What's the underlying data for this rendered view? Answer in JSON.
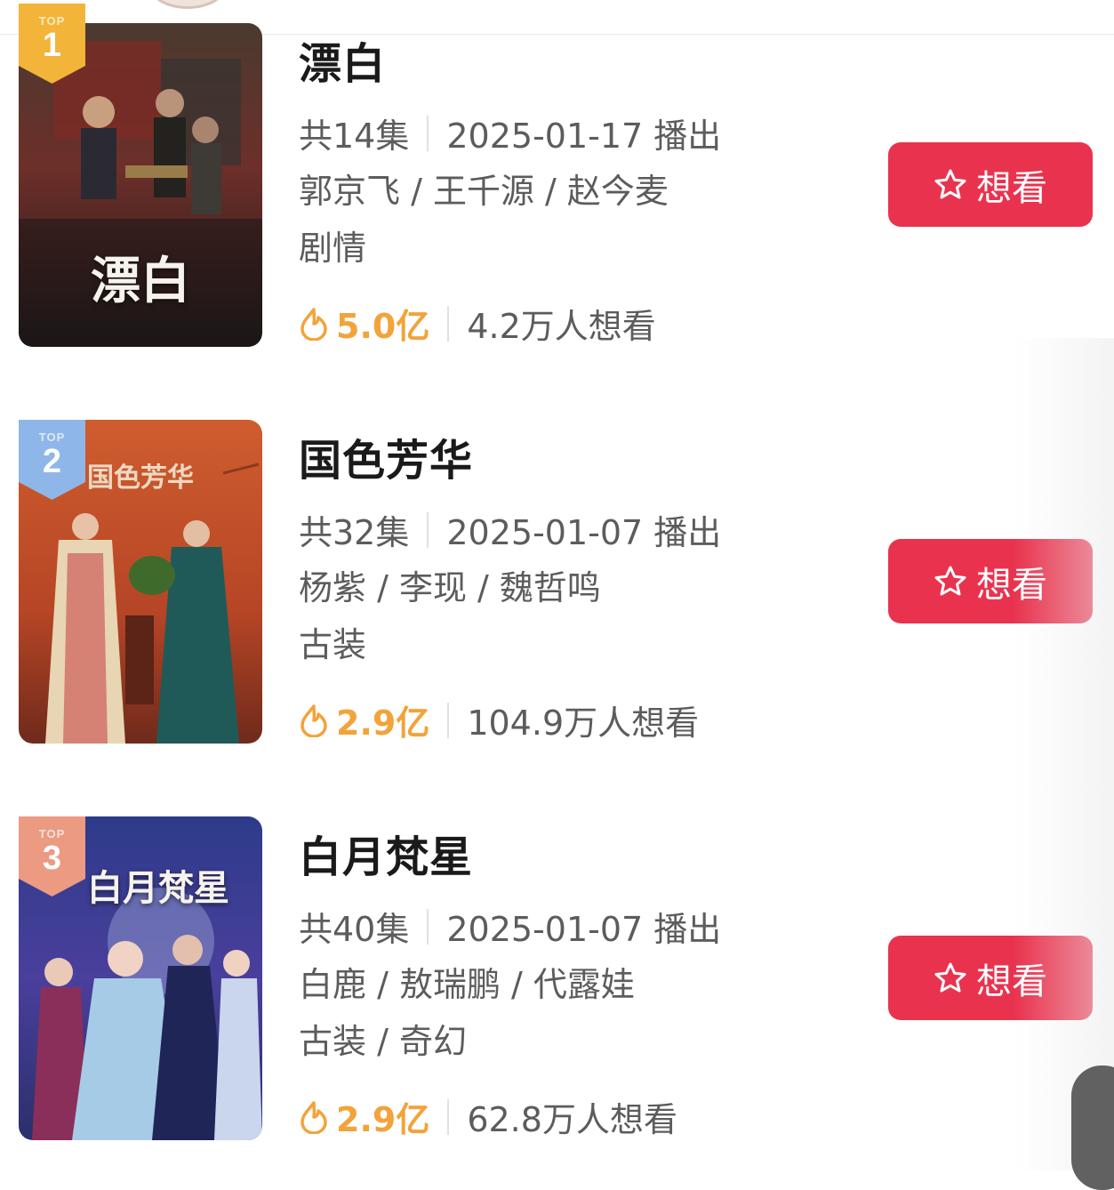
{
  "dramas": [
    {
      "rank": "1",
      "rank_label": "TOP",
      "title": "漂白",
      "poster_text": "漂白",
      "episodes": "共14集",
      "air": "2025-01-17 播出",
      "cast": "郭京飞 / 王千源 / 赵今麦",
      "genre": "剧情",
      "heat": "5.0亿",
      "want_count": "4.2万人想看",
      "button_label": "想看",
      "badge_color": "#f3b43a",
      "poster_colors": [
        "#3b2a24",
        "#7a2d2a",
        "#1e1a1a"
      ]
    },
    {
      "rank": "2",
      "rank_label": "TOP",
      "title": "国色芳华",
      "poster_text": "国色芳华",
      "episodes": "共32集",
      "air": "2025-01-07 播出",
      "cast": "杨紫 / 李现 / 魏哲鸣",
      "genre": "古装",
      "heat": "2.9亿",
      "want_count": "104.9万人想看",
      "button_label": "想看",
      "badge_color": "#8fb6e8",
      "poster_colors": [
        "#c8572c",
        "#b04322",
        "#7c2f1d"
      ]
    },
    {
      "rank": "3",
      "rank_label": "TOP",
      "title": "白月梵星",
      "poster_text": "白月梵星",
      "episodes": "共40集",
      "air": "2025-01-07 播出",
      "cast": "白鹿 / 敖瑞鹏 / 代露娃",
      "genre": "古装 / 奇幻",
      "heat": "2.9亿",
      "want_count": "62.8万人想看",
      "button_label": "想看",
      "badge_color": "#ec9a82",
      "poster_colors": [
        "#2e3f8c",
        "#4b3d9e",
        "#a9c4e6"
      ]
    }
  ],
  "colors": {
    "accent_button": "#e9334e",
    "heat_orange": "#f2a33a",
    "meta_gray": "#5c5c5c"
  },
  "icons": {
    "button_icon": "star-outline-icon",
    "heat_icon": "fire-icon"
  }
}
